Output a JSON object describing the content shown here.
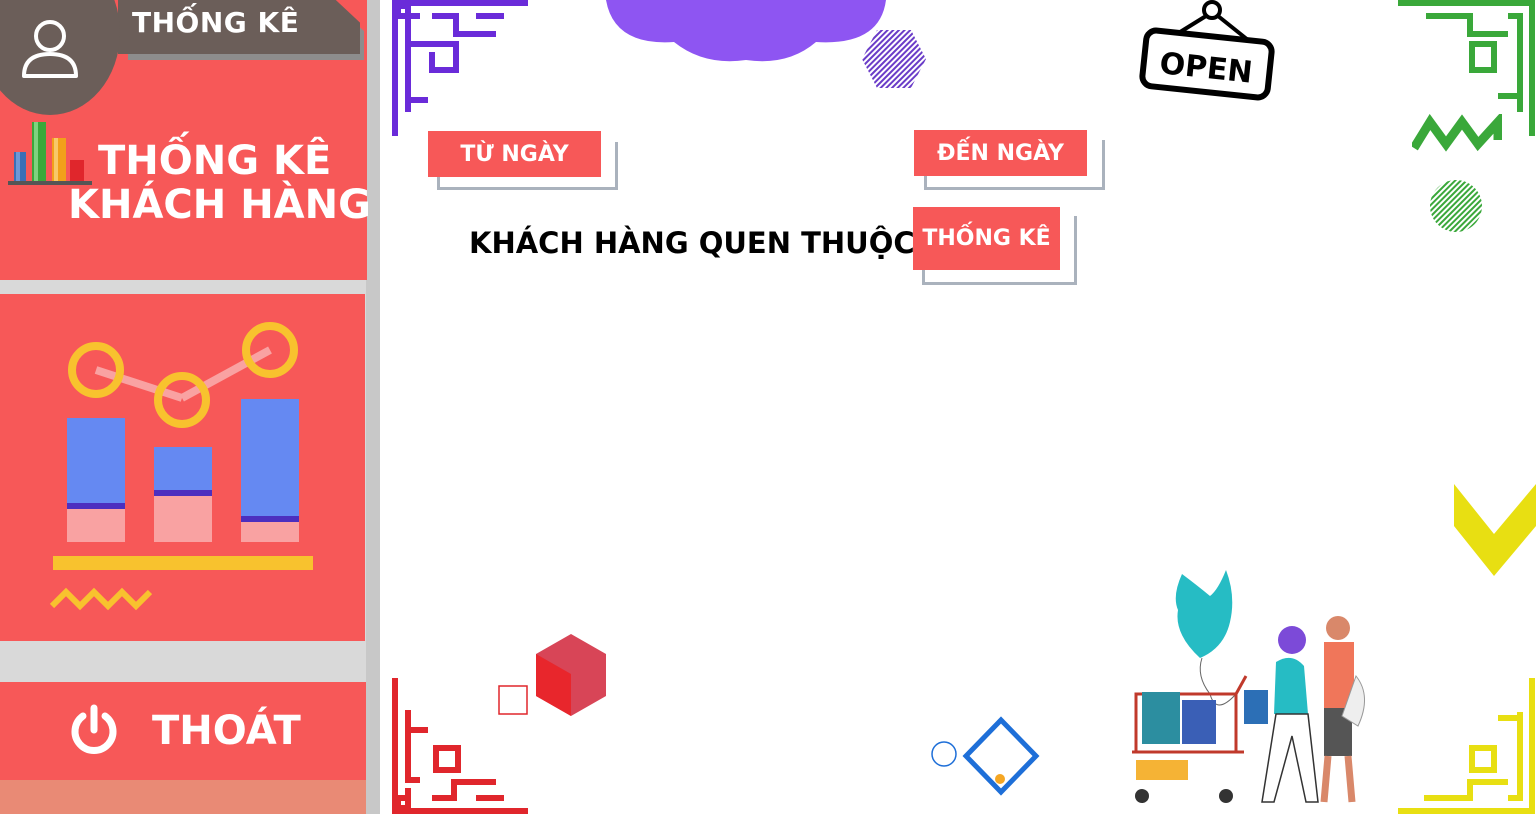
{
  "sidebar": {
    "header_tab": "THỐNG KÊ",
    "title_line1": "THỐNG KÊ",
    "title_line2": "KHÁCH HÀNG",
    "exit_label": "THOÁT"
  },
  "main": {
    "from_date_label": "TỪ NGÀY",
    "to_date_label": "ĐẾN NGÀY",
    "stats_button_label": "THỐNG KÊ",
    "section_title": "KHÁCH HÀNG QUEN THUỘC",
    "open_sign_text": "OPEN"
  },
  "colors": {
    "accent": "#f75858",
    "header_dark": "#6b5e59",
    "exit_strip": "#e98a75",
    "button_shadow": "#aab2bd"
  },
  "icons": {
    "user": "user-icon",
    "chart": "bar-chart-icon",
    "power": "power-icon"
  }
}
